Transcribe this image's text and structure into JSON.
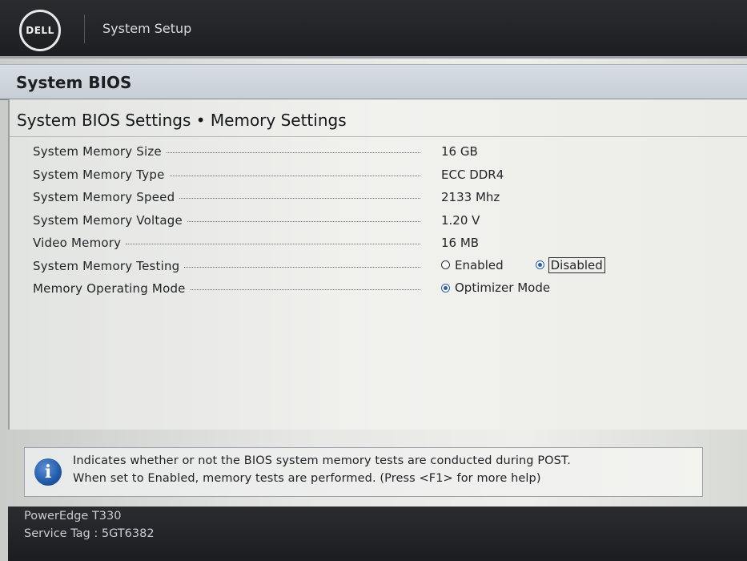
{
  "header": {
    "logo_text": "DELL",
    "app_title": "System Setup"
  },
  "page": {
    "title": "System BIOS",
    "section_title": "System BIOS Settings • Memory Settings"
  },
  "settings": {
    "rows": [
      {
        "label": "System Memory Size",
        "value": "16 GB"
      },
      {
        "label": "System Memory Type",
        "value": "ECC DDR4"
      },
      {
        "label": "System Memory Speed",
        "value": "2133 Mhz"
      },
      {
        "label": "System Memory Voltage",
        "value": "1.20 V"
      },
      {
        "label": "Video Memory",
        "value": "16 MB"
      }
    ],
    "memory_testing": {
      "label": "System Memory Testing",
      "options": [
        "Enabled",
        "Disabled"
      ],
      "selected": "Disabled"
    },
    "operating_mode": {
      "label": "Memory Operating Mode",
      "options": [
        "Optimizer Mode"
      ],
      "selected": "Optimizer Mode"
    }
  },
  "help": {
    "icon": "info-icon",
    "line1": "Indicates whether or not the BIOS system memory tests are conducted during POST.",
    "line2": "When set to Enabled, memory tests are performed. (Press <F1> for more help)"
  },
  "footer": {
    "model": "PowerEdge T330",
    "service_tag": "Service Tag : 5GT6382"
  },
  "colors": {
    "header_bg": "#1c1e22",
    "accent_radio": "#2f5e9e",
    "info_icon": "#1f5aa8"
  }
}
